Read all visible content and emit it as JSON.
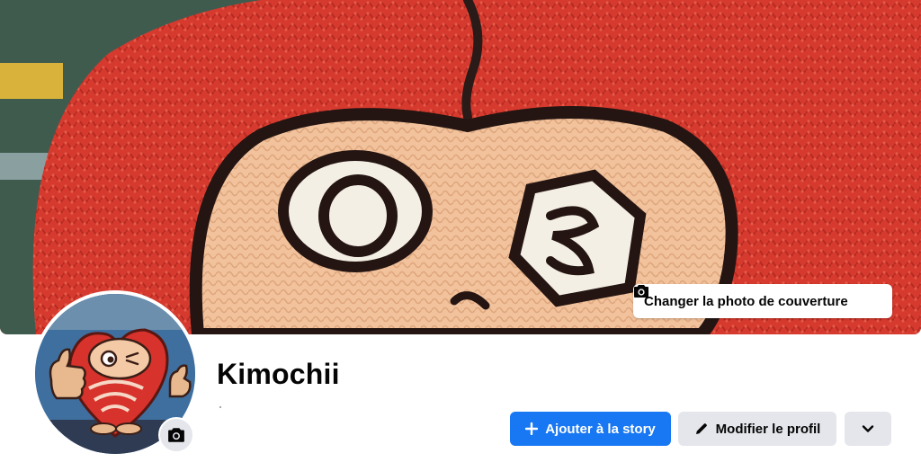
{
  "cover": {
    "change_label": "Changer la photo de couverture",
    "camera_icon": "camera-icon"
  },
  "profile": {
    "name": "Kimochii",
    "avatar_icon": "camera-icon",
    "subtitle": "·"
  },
  "actions": {
    "add_story_label": "Ajouter à la story",
    "add_story_icon": "plus-icon",
    "edit_profile_label": "Modifier le profil",
    "edit_profile_icon": "pencil-icon",
    "more_icon": "chevron-down-icon"
  },
  "colors": {
    "primary": "#1877f2",
    "secondary_button": "#e4e6eb",
    "text": "#050505",
    "cover_red": "#d9382e"
  }
}
